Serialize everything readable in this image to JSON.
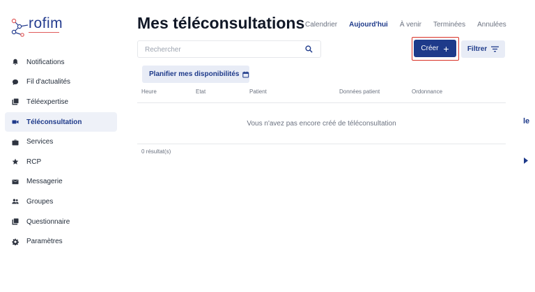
{
  "logo": {
    "text": "rofim"
  },
  "sidebar": {
    "items": [
      {
        "label": "Notifications",
        "icon": "bell-icon",
        "active": false
      },
      {
        "label": "Fil d'actualités",
        "icon": "chat-bubble-icon",
        "active": false
      },
      {
        "label": "Téléexpertise",
        "icon": "library-icon",
        "active": false
      },
      {
        "label": "Téléconsultation",
        "icon": "videocam-icon",
        "active": true
      },
      {
        "label": "Services",
        "icon": "briefcase-icon",
        "active": false
      },
      {
        "label": "RCP",
        "icon": "star-icon",
        "active": false
      },
      {
        "label": "Messagerie",
        "icon": "mail-icon",
        "active": false
      },
      {
        "label": "Groupes",
        "icon": "group-icon",
        "active": false
      },
      {
        "label": "Questionnaire",
        "icon": "library-icon",
        "active": false
      },
      {
        "label": "Paramètres",
        "icon": "gear-icon",
        "active": false
      }
    ]
  },
  "header": {
    "title": "Mes téléconsultations",
    "tabs": [
      {
        "label": "Calendrier",
        "active": false
      },
      {
        "label": "Aujourd'hui",
        "active": true
      },
      {
        "label": "À venir",
        "active": false
      },
      {
        "label": "Terminées",
        "active": false
      },
      {
        "label": "Annulées",
        "active": false
      }
    ]
  },
  "search": {
    "placeholder": "Rechercher",
    "value": ""
  },
  "toolbar": {
    "create_label": "Créer",
    "filter_label": "Filtrer",
    "plan_label": "Planifier mes disponibilités"
  },
  "table": {
    "columns": [
      "Heure",
      "Etat",
      "Patient",
      "Données patient",
      "Ordonnance"
    ],
    "empty_message": "Vous n'avez pas encore créé de téléconsultation",
    "results_count": "0 résultat(s)"
  },
  "edge": {
    "text": "le"
  },
  "colors": {
    "accent": "#1e3a8a",
    "accent_light": "#e8ecf6",
    "highlight": "#d93025"
  }
}
